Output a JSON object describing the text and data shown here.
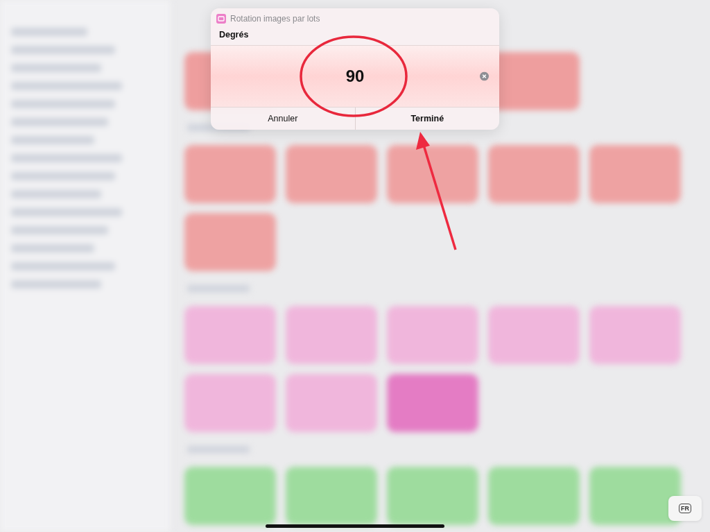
{
  "dialog": {
    "app_title": "Rotation images par lots",
    "label": "Degrés",
    "value": "90",
    "buttons": [
      {
        "label": "Annuler",
        "kind": "cancel"
      },
      {
        "label": "Terminé",
        "kind": "confirm"
      }
    ]
  },
  "sections": [
    {
      "rows": [
        [
          {
            "color": "#ee9e9e"
          },
          {
            "color": "#ee9e9e"
          }
        ]
      ]
    },
    {
      "rows": [
        [
          {
            "color": "#eea2a2"
          },
          {
            "color": "#eea2a2"
          },
          {
            "color": "#eea2a2"
          },
          {
            "color": "#eea2a2"
          },
          {
            "color": "#eea2a2"
          }
        ],
        [
          {
            "color": "#eea2a2"
          }
        ]
      ]
    },
    {
      "rows": [
        [
          {
            "color": "#f0b6dc"
          },
          {
            "color": "#f0b6dc"
          },
          {
            "color": "#f0b6dc"
          },
          {
            "color": "#f0b6dc"
          },
          {
            "color": "#f0b6dc"
          }
        ],
        [
          {
            "color": "#f0b6dc"
          },
          {
            "color": "#f0b6dc"
          },
          {
            "color": "#e47cc4"
          }
        ]
      ]
    },
    {
      "rows": [
        [
          {
            "color": "#9edc9e"
          },
          {
            "color": "#9edc9e"
          },
          {
            "color": "#9edc9e"
          },
          {
            "color": "#9edc9e"
          },
          {
            "color": "#9edc9e"
          }
        ]
      ]
    }
  ],
  "keyboard_button": "FR"
}
